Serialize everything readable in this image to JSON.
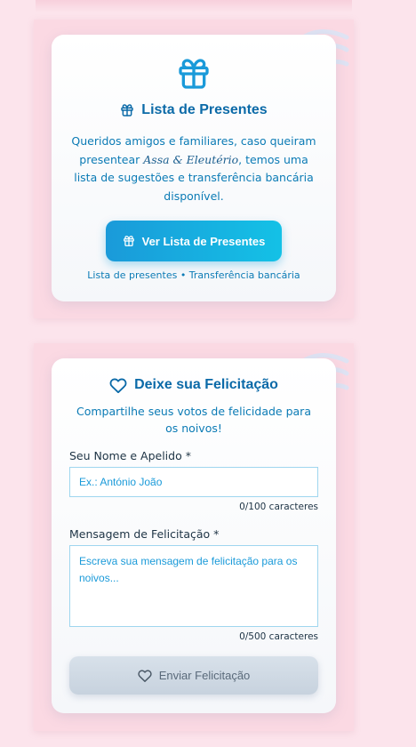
{
  "gift_card": {
    "icon": "gift-icon",
    "title": "Lista de Presentes",
    "description_before": "Queridos amigos e familiares, caso queiram presentear ",
    "couple_names": "Assa & Eleutério",
    "description_after": ", temos uma lista de sugestões e transferência bancária disponível.",
    "button_label": "Ver Lista de Presentes",
    "footer": "Lista de presentes • Transferência bancária"
  },
  "felicitation_card": {
    "icon": "heart-icon",
    "title": "Deixe sua Felicitação",
    "subtitle": "Compartilhe seus votos de felicidade para os noivos!",
    "name_label": "Seu Nome e Apelido *",
    "name_placeholder": "Ex.: António João",
    "name_counter": "0/100 caracteres",
    "message_label": "Mensagem de Felicitação *",
    "message_placeholder": "Escreva sua mensagem de felicitação para os noivos...",
    "message_counter": "0/500 caracteres",
    "send_label": "Enviar Felicitação"
  },
  "colors": {
    "page_background": "#fce4ec",
    "accent_blue": "#0b6aa8",
    "button_gradient_start": "#1a9ad9",
    "button_gradient_end": "#14c1e6",
    "disabled_button": "#d0dae4"
  }
}
